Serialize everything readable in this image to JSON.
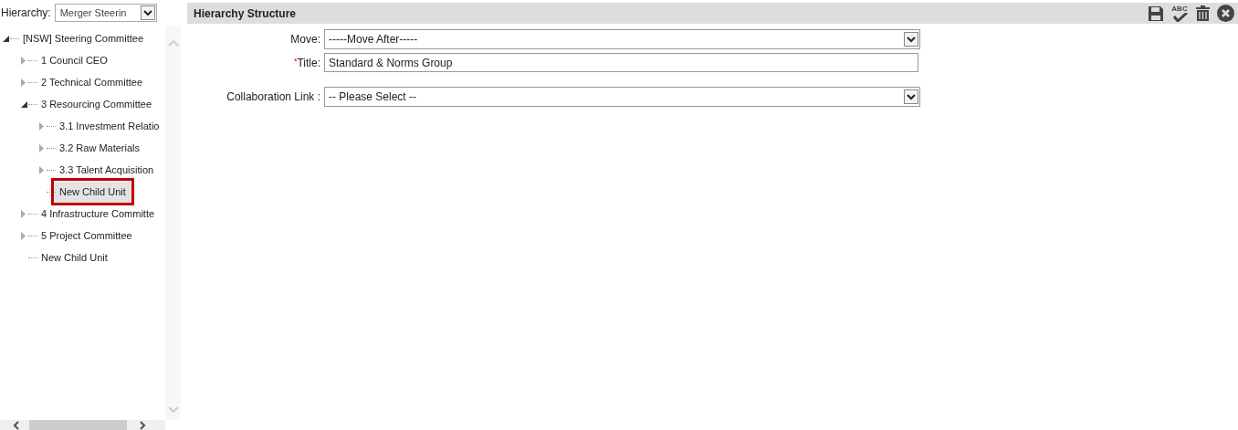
{
  "hierarchy": {
    "label": "Hierarchy:",
    "value": "Merger Steerin"
  },
  "tree": [
    {
      "label": "[NSW] Steering Committee",
      "kind": "branch",
      "expanded": true,
      "selected": false,
      "children": [
        {
          "label": "1 Council CEO",
          "kind": "collapsed",
          "selected": false
        },
        {
          "label": "2 Technical Committee",
          "kind": "collapsed",
          "selected": false
        },
        {
          "label": "3 Resourcing Committee",
          "kind": "branch",
          "expanded": true,
          "selected": false,
          "children": [
            {
              "label": "3.1 Investment Relatio",
              "kind": "collapsed",
              "selected": false
            },
            {
              "label": "3.2 Raw Materials",
              "kind": "collapsed",
              "selected": false
            },
            {
              "label": "3.3 Talent Acquisition",
              "kind": "collapsed",
              "selected": false
            },
            {
              "label": "New Child Unit",
              "kind": "leaf",
              "selected": true
            }
          ]
        },
        {
          "label": "4 Infrastructure Committe",
          "kind": "collapsed",
          "selected": false
        },
        {
          "label": "5 Project Committee",
          "kind": "collapsed",
          "selected": false
        },
        {
          "label": "New Child Unit",
          "kind": "leaf",
          "selected": false
        }
      ]
    }
  ],
  "panel": {
    "title": "Hierarchy Structure",
    "toolbar": [
      {
        "kind": "save"
      },
      {
        "kind": "spellcheck",
        "text": "ABC"
      },
      {
        "kind": "delete"
      },
      {
        "kind": "close"
      }
    ]
  },
  "form": [
    {
      "kind": "select",
      "label": "Move:",
      "value": "-----Move After-----"
    },
    {
      "kind": "text",
      "label": "Title:",
      "required_mark": "*",
      "value": "Standard & Norms Group"
    },
    {
      "kind": "select",
      "label": "Collaboration Link :",
      "value": "-- Please Select --"
    }
  ]
}
